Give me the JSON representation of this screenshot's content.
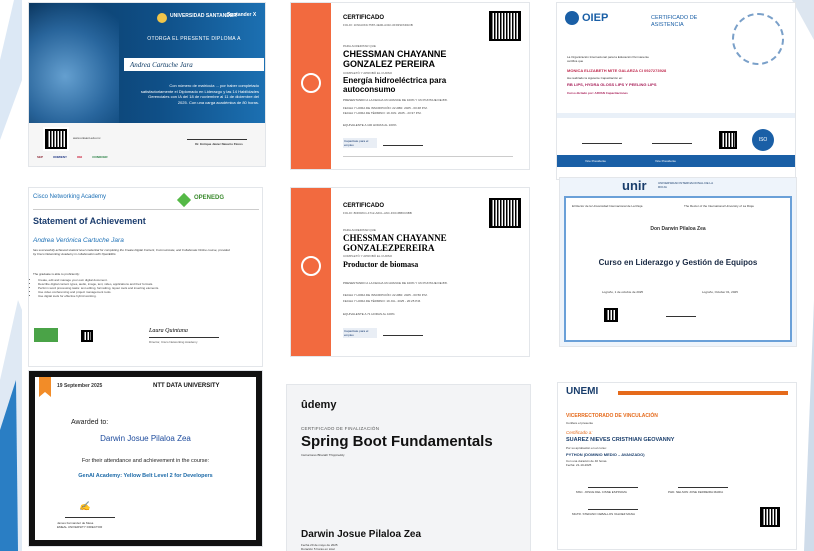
{
  "cert1": {
    "university": "UNIVERSIDAD SANTANDER",
    "logo2": "Santander X",
    "grant": "OTORGA EL PRESENTE DIPLOMA A",
    "name": "Andrea Cartuche Jara",
    "body": "Con número de matrícula ... por haber completado satisfactoriamente el Diplomado en Liderazgo y las 14 Habilidades Gerenciales con IA del 18 de noviembre al 11 de diciembre del 2025. Con una carga académica de 80 horas.",
    "site": "www.unisant.edu.mx",
    "signer": "Dr. Enrique Javier Navarro Flores",
    "partners": [
      "SEP",
      "ONMIENY",
      "OEI",
      "CONOCER"
    ]
  },
  "cert2": {
    "header": "CERTIFICADO",
    "folio": "FOLIO: 1FNIA0K9-7587-4E00-A31F-0F93SF6D1DB",
    "awarded_label": "PARA ACREDITAR QUE",
    "name": "CHESSMAN CHAYANNE GONZALEZ PEREIRA",
    "completed_label": "COMPLETÓ Y APROBÓ EL CURSO",
    "course": "Energía hidroeléctrica para autoconsumo",
    "line1": "PRESENTANDO A LA FECHA UN AVANCE DE 100% Y UN PUNTAJE DE 8/8.",
    "line2": "FECHA Y HORA DE INSCRIPCIÓN: 22 ABR. 2025 - 00:48 P.M.",
    "line3": "FECHA Y HORA DE TÉRMINO: 19 JUN. 2025 - 23:37 P.M.",
    "equiv": "EQUIVALENTE A 100 HORAS AL 100%",
    "logo": "Capacitate para el empleo"
  },
  "cert3": {
    "org": "OIEP",
    "title": "CERTIFICADO DE ASISTENCIA",
    "intro": "La Organización Internacional para la Educación Permanente certifica que",
    "name": "MONICA ELIZABETH MITE GALARZA CI 0927273928",
    "event_label": "Ha realizado la siguiente Capacitación en:",
    "event": "RB LIPS, HYDRA GLOSS LIPS Y PEELING LIPS",
    "org_label": "Curso dictado por: ARVAN Capacitaciones",
    "signer1": "Vice Presidente",
    "signer2": "Vice Presidente",
    "badge": "ISO"
  },
  "cert4": {
    "brand": "Cisco Networking Academy",
    "partner": "OPENEDG",
    "title": "Statement of Achievement",
    "name": "Andrea Verónica Cartuche Jara",
    "body": "has successfully achieved student level credential for completing the Create Digital Content, Communicate, and Collaborate Online course, provided by Cisco Networking Academy in collaboration with OpenEDG.",
    "able": "The graduate is able to proficiently:",
    "bullets": [
      "Create, edit and manage your own digital document.",
      "Describe digital content types, audio, image, text, video, applications and their formats.",
      "Perform word processing tasks: text editing, formatting, layout tools and inserting elements.",
      "Use video conferencing and project management tools.",
      "Use digital tools for effective hybrid working."
    ],
    "signer": "Laura Quintana",
    "signer_title": "Director, Cisco Networking Academy"
  },
  "cert5": {
    "header": "CERTIFICADO",
    "folio": "FOLIO: 8DPA8C1-4712-A6CL-A6C-FDC45B6C9BB",
    "awarded_label": "PARA ACREDITAR QUE",
    "name": "CHESSMAN CHAYANNE GONZALEZPEREIRA",
    "completed_label": "COMPLETÓ Y APROBÓ EL CURSO",
    "course": "Productor de biomasa",
    "line1": "PRESENTANDO A LA FECHA UN AVANCE DE 100% Y UN PUNTAJE DE 8/8.",
    "line2": "FECHA Y HORA DE INSCRIPCIÓN: 22 ABR. 2025 - 00:50 P.M.",
    "line3": "FECHA Y HORA DE TÉRMINO: 19 JUL. 2025 - 20:25 P.M.",
    "equiv": "EQUIVALENTE A 71 HORAS AL 100%",
    "logo": "Capacitate para el empleo"
  },
  "cert6": {
    "brand": "unir",
    "brand_sub": "UNIVERSIDAD INTERNACIONAL DE LA RIOJA",
    "col_es": "El Rector de la Universidad Internacional de La Rioja",
    "col_en": "The Rector of the International University of La Rioja",
    "name": "Don Darwin Pilaloa Zea",
    "course": "Curso en Liderazgo y Gestión de Equipos",
    "date_es": "Logroño, 1 de octubre de 2025",
    "date_en": "Logroño, October 01, 2025"
  },
  "cert7": {
    "date": "19 September 2025",
    "brand": "NTT DATA UNIVERSITY",
    "awarded": "Awarded to:",
    "name": "Darwin Josue Pilaloa Zea",
    "reason": "For their attendance and achievement in the course:",
    "course": "GenAI Academy: Yellow Belt Level 2 for Developers",
    "signer": "James Fernandez de Mesa",
    "signer_title": "EMEAL UNIVERSITY DIRECTOR"
  },
  "cert8": {
    "brand": "ûdemy",
    "label": "CERTIFICADO DE FINALIZACIÓN",
    "course": "Spring Boot Fundamentals",
    "instructor": "Instructores  Bharath Thippireddy",
    "name": "Darwin Josue Pilaloa Zea",
    "date": "Fecha  20 de mayo de 2025",
    "duration": "Duración  5 horas en total"
  },
  "cert9": {
    "brand": "UNEMI",
    "vice": "VICERRECTORADO DE VINCULACIÓN",
    "confer": "Confiere el presente",
    "cert_label": "Certificado a:",
    "name": "SUAREZ NIEVES CRISTHIAN GEOVANNY",
    "approved": "Por su aprobación en el curso:",
    "course": "PYTHON (DOMINIO MEDIO – AVANZADO)",
    "hours": "Con una duración de 40 horas.",
    "date": "Fecha: 21-10-2025",
    "signer1": "MSC. JOSUE DEL CISNE ESPINOZA",
    "signer2": "PHD. NELSON JOSE FERREIRA MARIA",
    "signer3": "MGTR. STEFANO CEBALLOS VALDEZ MANA"
  },
  "colors": {
    "orange": "#f26a3f",
    "cisco_blue": "#1b6fb5",
    "udemy_purple": "#a435f0",
    "unemi_orange": "#e56a1b",
    "oiep_blue": "#1a5fa6"
  }
}
